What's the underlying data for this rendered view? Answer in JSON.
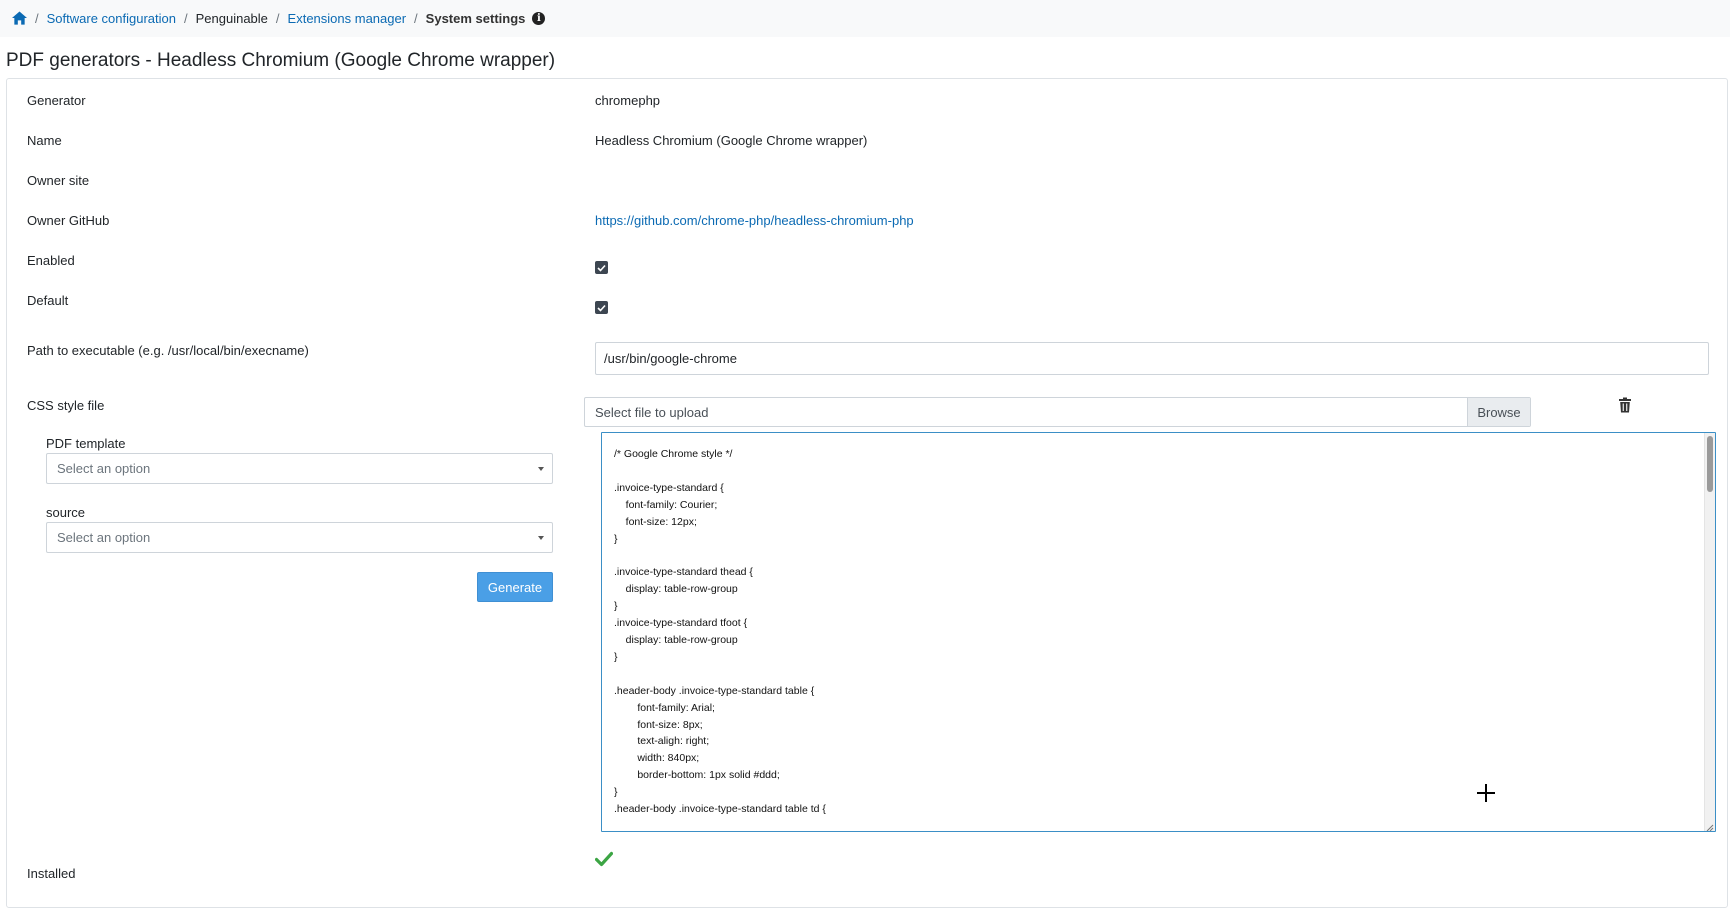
{
  "breadcrumb": {
    "home_icon": "home-icon",
    "items": [
      "Software configuration",
      "Penguinable",
      "Extensions manager",
      "System settings"
    ],
    "separator": "/",
    "info_icon": "info-icon"
  },
  "page": {
    "title": "PDF generators - Headless Chromium (Google Chrome wrapper)"
  },
  "fields": {
    "generator": {
      "label": "Generator",
      "value": "chromephp"
    },
    "name": {
      "label": "Name",
      "value": "Headless Chromium (Google Chrome wrapper)"
    },
    "owner_site": {
      "label": "Owner site",
      "value": ""
    },
    "owner_github": {
      "label": "Owner GitHub",
      "value": "https://github.com/chrome-php/headless-chromium-php"
    },
    "enabled": {
      "label": "Enabled",
      "checked": true
    },
    "default": {
      "label": "Default",
      "checked": true
    },
    "path": {
      "label": "Path to executable (e.g. /usr/local/bin/execname)",
      "value": "/usr/bin/google-chrome"
    },
    "css_file": {
      "label": "CSS style file",
      "placeholder": "Select file to upload",
      "browse_label": "Browse",
      "delete_icon": "trash-icon",
      "content": "/* Google Chrome style */\n\n.invoice-type-standard {\n    font-family: Courier;\n    font-size: 12px;\n}\n\n.invoice-type-standard thead {\n    display: table-row-group\n}\n.invoice-type-standard tfoot {\n    display: table-row-group\n}\n\n.header-body .invoice-type-standard table {\n        font-family: Arial;\n        font-size: 8px;\n        text-aligh: right;\n        width: 840px;\n        border-bottom: 1px solid #ddd;\n}\n.header-body .invoice-type-standard table td {"
    },
    "pdf_template": {
      "label": "PDF template",
      "placeholder": "Select an option"
    },
    "source": {
      "label": "source",
      "placeholder": "Select an option"
    },
    "generate_label": "Generate",
    "installed": {
      "label": "Installed",
      "status_icon": "checkmark-icon",
      "status_color": "#3ca544"
    }
  },
  "colors": {
    "link": "#0b6ab3",
    "primary_button": "#4a9fe6",
    "checkbox": "#3d4651",
    "textarea_border": "#3b8fc6"
  }
}
